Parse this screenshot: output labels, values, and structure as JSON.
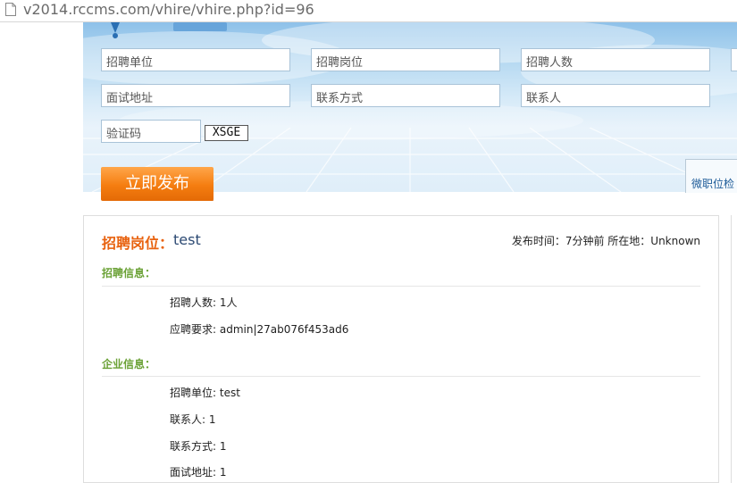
{
  "browser": {
    "url": "v2014.rccms.com/vhire/vhire.php?id=96"
  },
  "form": {
    "company_placeholder": "招聘单位",
    "position_placeholder": "招聘岗位",
    "headcount_placeholder": "招聘人数",
    "address_placeholder": "面试地址",
    "contact_method_placeholder": "联系方式",
    "contact_person_placeholder": "联系人",
    "captcha_placeholder": "验证码",
    "captcha_code": "XSGE",
    "publish_label": "立即发布"
  },
  "side_tab": {
    "label": "微职位检"
  },
  "posting": {
    "title_label": "招聘岗位：",
    "title_value": "test",
    "meta": "发布时间：7分钟前 所在地：Unknown",
    "recruit_section": "招聘信息：",
    "recruit_rows": [
      {
        "key": "招聘人数:",
        "value": "1人"
      },
      {
        "key": "应聘要求:",
        "value": "admin|27ab076f453ad6"
      }
    ],
    "company_section": "企业信息：",
    "company_rows": [
      {
        "key": "招聘单位:",
        "value": "test"
      },
      {
        "key": "联系人:",
        "value": "1"
      },
      {
        "key": "联系方式:",
        "value": "1"
      },
      {
        "key": "面试地址:",
        "value": "1"
      }
    ]
  },
  "colors": {
    "accent_orange": "#f57d10",
    "title_orange": "#e8620f",
    "section_green": "#6aa135",
    "link_blue": "#1d5b98"
  }
}
